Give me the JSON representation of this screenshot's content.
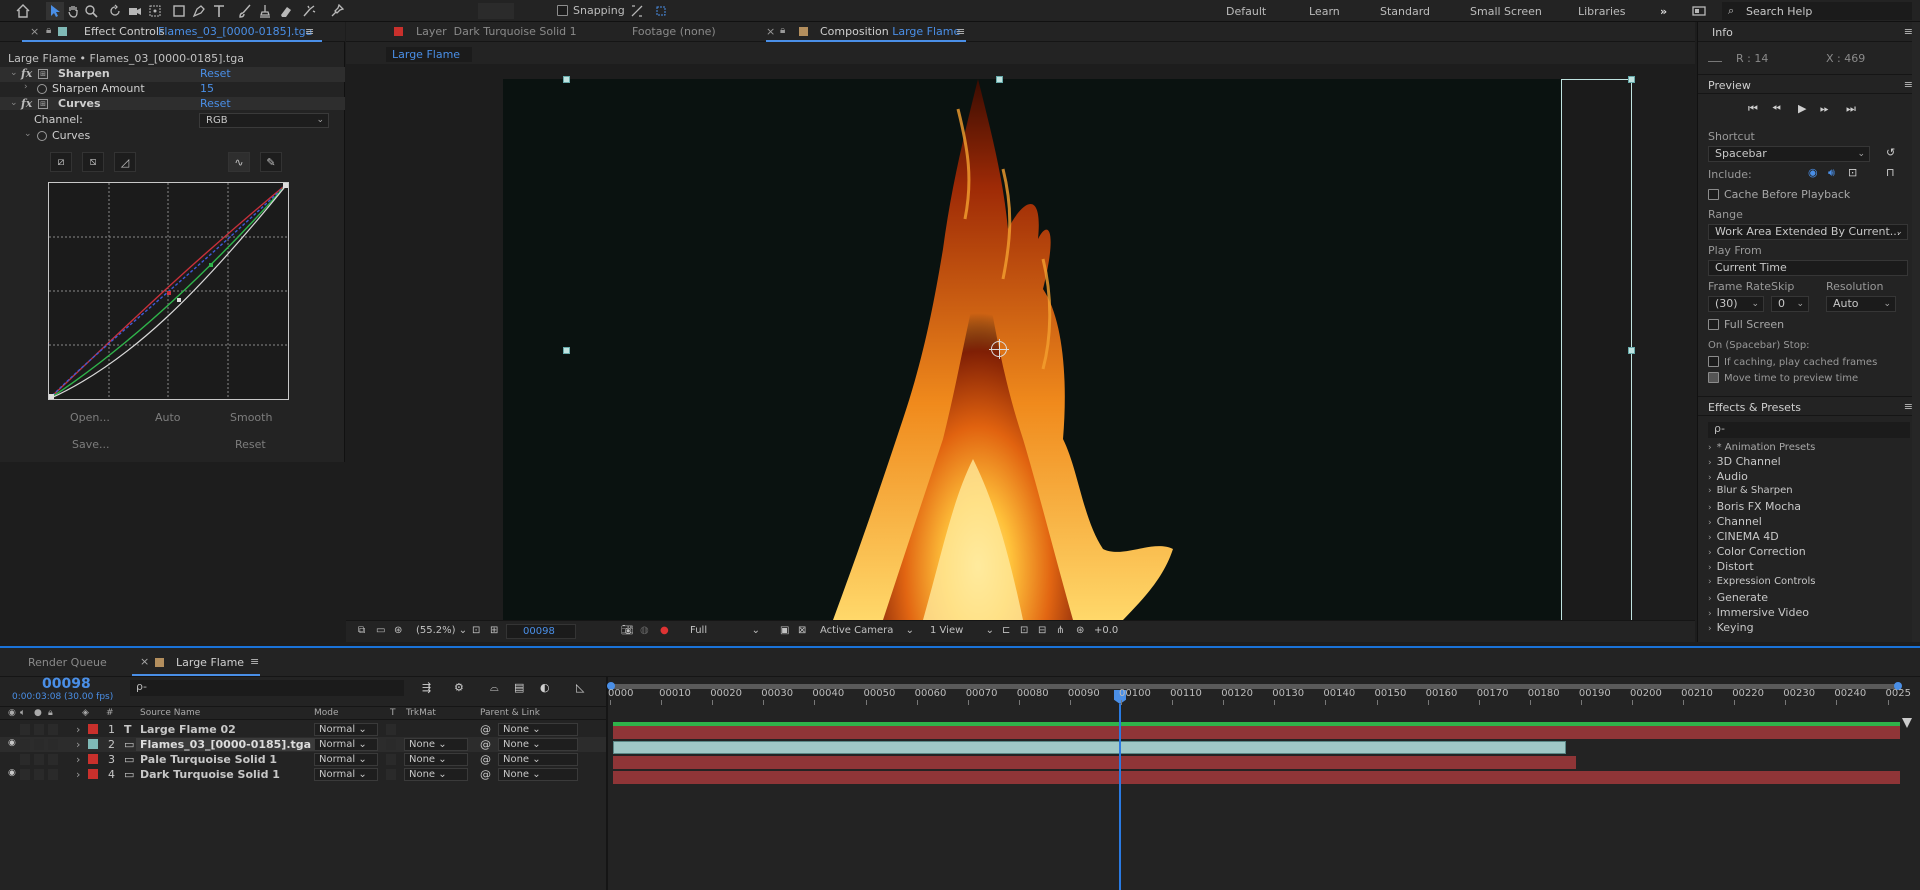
{
  "toolbar": {
    "snapping_label": "Snapping",
    "workspaces": [
      "Default",
      "Learn",
      "Standard",
      "Small Screen",
      "Libraries"
    ],
    "search_placeholder": "Search Help"
  },
  "effect_controls": {
    "tab_prefix": "Effect Controls",
    "tab_file": "Flames_03_[0000-0185].tga",
    "breadcrumb": "Large Flame • Flames_03_[0000-0185].tga",
    "sharpen": {
      "name": "Sharpen",
      "reset": "Reset",
      "amount_label": "Sharpen Amount",
      "amount_value": "15"
    },
    "curves": {
      "name": "Curves",
      "reset": "Reset",
      "channel_label": "Channel:",
      "channel_value": "RGB",
      "sub_label": "Curves"
    },
    "buttons": {
      "open": "Open...",
      "auto": "Auto",
      "smooth": "Smooth",
      "save": "Save...",
      "reset": "Reset"
    }
  },
  "viewer": {
    "tabs": {
      "layer_prefix": "Layer",
      "layer_name": "Dark Turquoise Solid 1",
      "footage": "Footage (none)",
      "comp_prefix": "Composition",
      "comp_name": "Large Flame"
    },
    "breadcrumb": "Large Flame",
    "bottom": {
      "zoom": "(55.2%)",
      "timecode": "00098",
      "resolution": "Full",
      "camera": "Active Camera",
      "views": "1 View",
      "exposure": "+0.0"
    }
  },
  "right_panel": {
    "info": {
      "title": "Info",
      "r_label": "R :",
      "r_value": "14",
      "x_label": "X :",
      "x_value": "469"
    },
    "preview": {
      "title": "Preview",
      "shortcut_label": "Shortcut",
      "shortcut_value": "Spacebar",
      "include_label": "Include:",
      "cache_label": "Cache Before Playback",
      "range_label": "Range",
      "range_value": "Work Area Extended By Current...",
      "play_from_label": "Play From",
      "play_from_value": "Current Time",
      "frame_rate_label": "Frame Rate",
      "skip_label": "Skip",
      "resolution_label": "Resolution",
      "frame_rate_value": "(30)",
      "skip_value": "0",
      "resolution_value": "Auto",
      "full_screen_label": "Full Screen",
      "stop_label": "On (Spacebar) Stop:",
      "if_caching_label": "If caching, play cached frames",
      "move_time_label": "Move time to preview time"
    },
    "effects_presets": {
      "title": "Effects & Presets",
      "search_placeholder": "ρ-",
      "items": [
        "* Animation Presets",
        "3D Channel",
        "Audio",
        "Blur & Sharpen",
        "Boris FX Mocha",
        "Channel",
        "CINEMA 4D",
        "Color Correction",
        "Distort",
        "Expression Controls",
        "Generate",
        "Immersive Video",
        "Keying"
      ]
    }
  },
  "timeline": {
    "render_queue_tab": "Render Queue",
    "comp_tab": "Large Flame",
    "current_time": "00098",
    "time_sub": "0:00:03:08 (30.00 fps)",
    "search_placeholder": "ρ-",
    "columns": {
      "number": "#",
      "source": "Source Name",
      "mode": "Mode",
      "t": "T",
      "trkmat": "TrkMat",
      "parent": "Parent & Link"
    },
    "layers": [
      {
        "num": "1",
        "name": "Large Flame 02",
        "mode": "Normal",
        "trkmat": "",
        "parent": "None",
        "color": "#c9302c",
        "is_text": true,
        "visible": false
      },
      {
        "num": "2",
        "name": "Flames_03_[0000-0185].tga",
        "mode": "Normal",
        "trkmat": "None",
        "parent": "None",
        "color": "#7fb9b6",
        "is_text": false,
        "visible": true
      },
      {
        "num": "3",
        "name": "Pale Turquoise Solid 1",
        "mode": "Normal",
        "trkmat": "None",
        "parent": "None",
        "color": "#c9302c",
        "is_text": false,
        "visible": false
      },
      {
        "num": "4",
        "name": "Dark Turquoise Solid 1",
        "mode": "Normal",
        "trkmat": "None",
        "parent": "None",
        "color": "#c9302c",
        "is_text": false,
        "visible": true
      }
    ],
    "ruler_labels": [
      "0000",
      "00010",
      "00020",
      "00030",
      "00040",
      "00050",
      "00060",
      "00070",
      "00080",
      "00090",
      "00100",
      "00110",
      "00120",
      "00130",
      "00140",
      "00150",
      "00160",
      "00170",
      "00180",
      "00190",
      "00200",
      "00210",
      "00220",
      "00230",
      "00240",
      "0025"
    ],
    "colors": {
      "accent": "#4a8fe7",
      "bar_red": "#8f3537",
      "bar_teal": "#9fc8c6"
    }
  }
}
